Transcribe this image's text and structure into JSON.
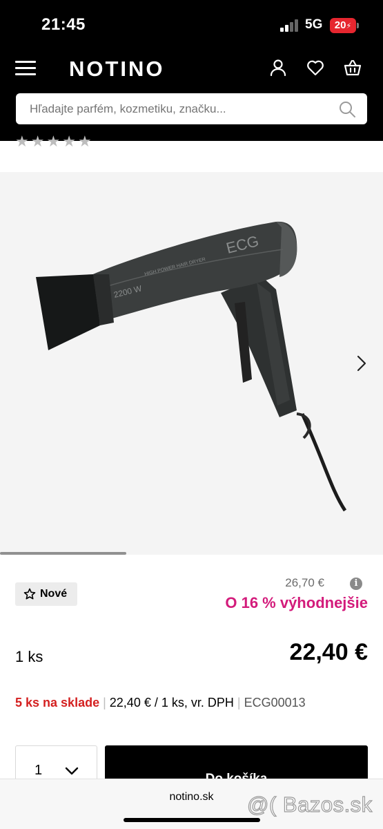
{
  "status_bar": {
    "time": "21:45",
    "network": "5G",
    "battery": "20"
  },
  "header": {
    "logo": "NOTINO"
  },
  "search": {
    "placeholder": "Hľadajte parfém, kozmetiku, značku..."
  },
  "rating": {
    "stars": 5,
    "filled": 0
  },
  "gallery": {
    "progress": 0.33,
    "product_label": "ECG",
    "product_sublabel": "HIGH POWER HAIR DRYER",
    "product_wattage": "2200 W"
  },
  "product": {
    "badge": "Nové",
    "old_price": "26,70 €",
    "discount": "O 16 % výhodnejšie",
    "quantity_label": "1 ks",
    "price": "22,40 €",
    "stock": "5 ks na sklade",
    "unit_price": "22,40 € / 1 ks, vr. DPH",
    "code": "ECG00013"
  },
  "cart": {
    "quantity": "1",
    "add_label": "Do košíka"
  },
  "browser": {
    "url": "notino.sk"
  },
  "watermark": "@( Bazos.sk",
  "colors": {
    "accent_pink": "#d31b7b",
    "stock_red": "#d42020",
    "header_bg": "#000000"
  }
}
